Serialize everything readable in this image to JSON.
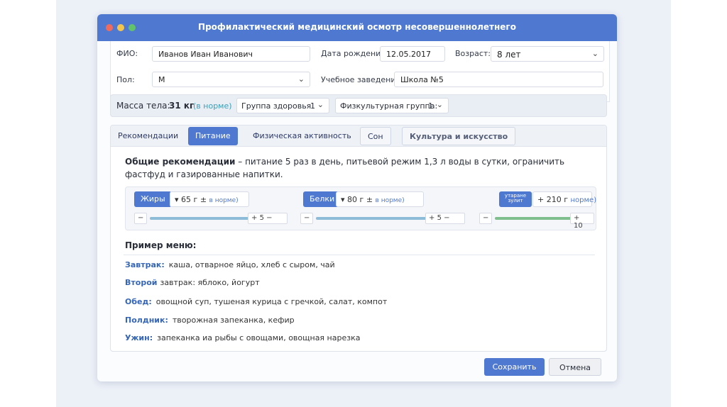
{
  "window": {
    "title": "Профилактический медицинский осмотр несовершеннолетнего",
    "dot_colors": [
      "#ef6b5e",
      "#f3c54c",
      "#63c36b"
    ]
  },
  "form": {
    "fio_label": "ФИО:",
    "fio_value": "Иванов Иван Иванович",
    "birth_label": "Дата рождения:",
    "birth_value": "12.05.2017",
    "age_label": "Возраст:",
    "age_value": "8 лет",
    "sex_label": "Пол:",
    "sex_value": "М",
    "school_label": "Учебное заведение:",
    "school_value": "Школа №5"
  },
  "health": {
    "mass_label": "Масса тела:",
    "mass_value": "31 кг",
    "mass_status": "(в норме)",
    "group_label": "Группа здоровья",
    "group_value": "1",
    "pe_label": "Физкультурная группа:",
    "pe_value": "1"
  },
  "tabs": [
    {
      "label": "Рекомендации",
      "active": false
    },
    {
      "label": "Питание",
      "active": true
    },
    {
      "label": "Физическая активность",
      "active": false
    },
    {
      "label": "Сон",
      "active": false
    },
    {
      "label": "Культура и искусство",
      "active": false
    }
  ],
  "nutrition": {
    "general_title": "Общие рекомендации",
    "general_text": " – питание 5 раз в день, питьевой режим 1,3 л воды в сутки, ограничить фастфуд и газированные напитки.",
    "macros": [
      {
        "name": "Жиры",
        "value": "65 г",
        "pm": "±",
        "status": "в норме)",
        "step": "5",
        "fill": 0.85
      },
      {
        "name": "Белки",
        "value": "80 г",
        "pm": "±",
        "status": "в норме)",
        "step": "5",
        "fill": 0.85
      },
      {
        "name": "утарaне зулит",
        "value": "210 г",
        "pm": "",
        "status": "норме)",
        "step": "10",
        "fill": 0.9
      }
    ],
    "menu_title": "Пример меню:",
    "meals": [
      {
        "label": "Завтрак:",
        "text": "каша, отварное яйцо, хлеб с сыром, чай"
      },
      {
        "label": "Второй",
        "text": "завтрак: яблоко, йогурт"
      },
      {
        "label": "Обед:",
        "text": "овощной суп, тушеная курица с гречкой, салат, компот"
      },
      {
        "label": "Полдник:",
        "text": "творожная запеканка, кефир"
      },
      {
        "label": "Ужин:",
        "text": "запеканка иа рыбы с овощами, овощная нарезка"
      }
    ]
  },
  "buttons": {
    "save": "Сохранить",
    "cancel": "Отмена"
  },
  "colors": {
    "accent": "#4f79d0",
    "slider": "#8cbcd8"
  }
}
